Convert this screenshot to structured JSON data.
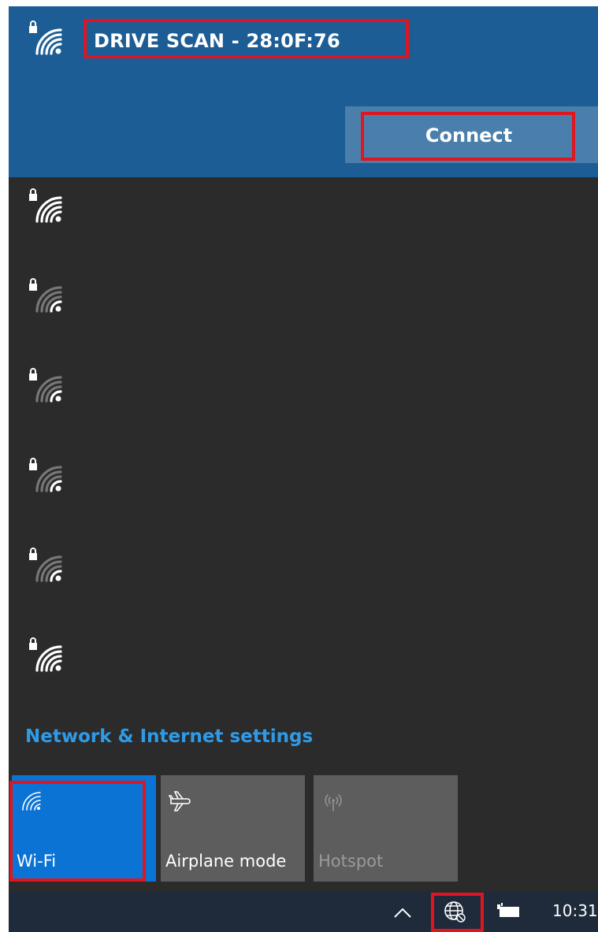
{
  "selected_network": {
    "ssid": "DRIVE SCAN - 28:0F:76",
    "connect_label": "Connect",
    "icon": "wifi-secured-full-icon"
  },
  "networks": [
    {
      "icon": "wifi-secured-full-icon",
      "signal": "full"
    },
    {
      "icon": "wifi-secured-weak-icon",
      "signal": "weak"
    },
    {
      "icon": "wifi-secured-weak-icon",
      "signal": "weak"
    },
    {
      "icon": "wifi-secured-weak-icon",
      "signal": "weak"
    },
    {
      "icon": "wifi-secured-weak-icon",
      "signal": "weak"
    },
    {
      "icon": "wifi-secured-full-icon",
      "signal": "full"
    }
  ],
  "settings_link": "Network & Internet settings",
  "quick_actions": {
    "wifi": {
      "label": "Wi-Fi",
      "icon": "wifi-icon",
      "state": "on"
    },
    "airplane": {
      "label": "Airplane mode",
      "icon": "airplane-icon",
      "state": "off"
    },
    "hotspot": {
      "label": "Hotspot",
      "icon": "hotspot-icon",
      "state": "disabled"
    }
  },
  "taskbar": {
    "clock": "10:31",
    "icons": [
      "chevron-up-icon",
      "globe-icon",
      "battery-icon"
    ]
  },
  "colors": {
    "accent": "#0a73d4",
    "selected_bg": "#1c5d95",
    "flyout_bg": "#2b2b2b",
    "highlight": "#e0151f",
    "link": "#2e9be8"
  }
}
